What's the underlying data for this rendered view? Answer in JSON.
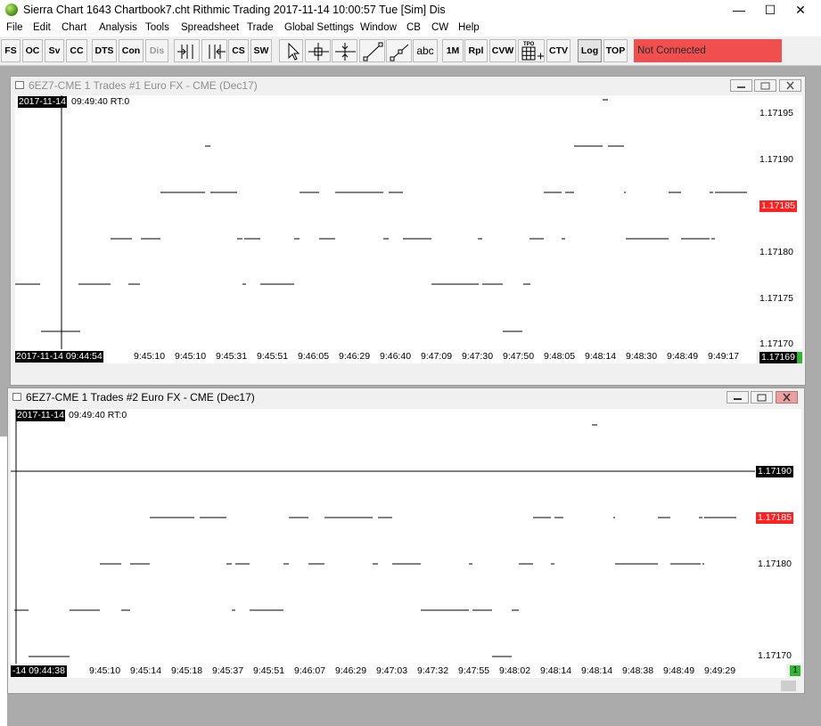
{
  "app": {
    "title": "Sierra Chart 1643 Chartbook7.cht  Rithmic Trading 2017-11-14  10:00:57 Tue [Sim]  Dis",
    "window_controls": {
      "minimize": "—",
      "maximize": "☐",
      "close": "✕"
    }
  },
  "menu": [
    "File",
    "Edit",
    "Chart",
    "Analysis",
    "Tools",
    "Spreadsheet",
    "Trade",
    "Global Settings",
    "Window",
    "CB",
    "CW",
    "Help"
  ],
  "toolbar": {
    "buttons": [
      "FS",
      "OC",
      "Sv",
      "CC",
      "DTS",
      "Con",
      "Dis",
      "",
      "",
      "CS",
      "SW",
      "",
      "",
      "",
      "",
      "",
      "abc",
      "1M",
      "Rpl",
      "CVW",
      "",
      "CTV",
      "Log",
      "TOP"
    ],
    "icons": [
      "bar-left-icon",
      "bar-right-icon",
      "pointer-arrow-icon",
      "crosshair-icon",
      "cursor-line-icon",
      "draw-line-icon",
      "draw-ray-icon",
      "tpo-grid-icon"
    ],
    "tpo_label": "TPO",
    "status_text": "Not Connected",
    "status_color": "#f14f4f"
  },
  "charts": [
    {
      "title": "6EZ7-CME  1 Trades  #1  Euro FX - CME (Dec17)",
      "state": "inactive",
      "date_tag": "2017-11-14",
      "time_tag": "09:49:40 RT:0",
      "price_labels": [
        "1.17195",
        "1.17190",
        "1.17185",
        "1.17180",
        "1.17175",
        "1.17170"
      ],
      "current_price": "1.17185",
      "cursor_price": "1.17169",
      "time_labels": [
        "9:45:10",
        "9:45:10",
        "9:45:31",
        "9:45:51",
        "9:46:05",
        "9:46:29",
        "9:46:40",
        "9:47:09",
        "9:47:30",
        "9:47:50",
        "9:48:05",
        "9:48:14",
        "9:48:30",
        "9:48:49",
        "9:49:17"
      ],
      "cursor_time": "2017-11-14  09:44:54"
    },
    {
      "title": "6EZ7-CME  1 Trades  #2  Euro FX - CME (Dec17)",
      "state": "active",
      "date_tag": "2017-11-14",
      "time_tag": "09:49:40 RT:0",
      "price_labels": [
        "1.17190",
        "1.17185",
        "1.17180",
        "1.17170"
      ],
      "current_price": "1.17185",
      "cursor_price": "1.17190",
      "time_labels": [
        "9:45:10",
        "9:45:14",
        "9:45:18",
        "9:45:37",
        "9:45:51",
        "9:46:07",
        "9:46:29",
        "9:47:03",
        "9:47:32",
        "9:47:55",
        "9:48:02",
        "9:48:14",
        "9:48:14",
        "9:48:38",
        "9:48:49",
        "9:49:29"
      ],
      "cursor_time": "-14  09:44:38",
      "indicator": "1"
    }
  ],
  "colors": {
    "price_highlight": "#ff2020",
    "cursor_bg": "#000000",
    "indicator": "#2eb82e"
  }
}
